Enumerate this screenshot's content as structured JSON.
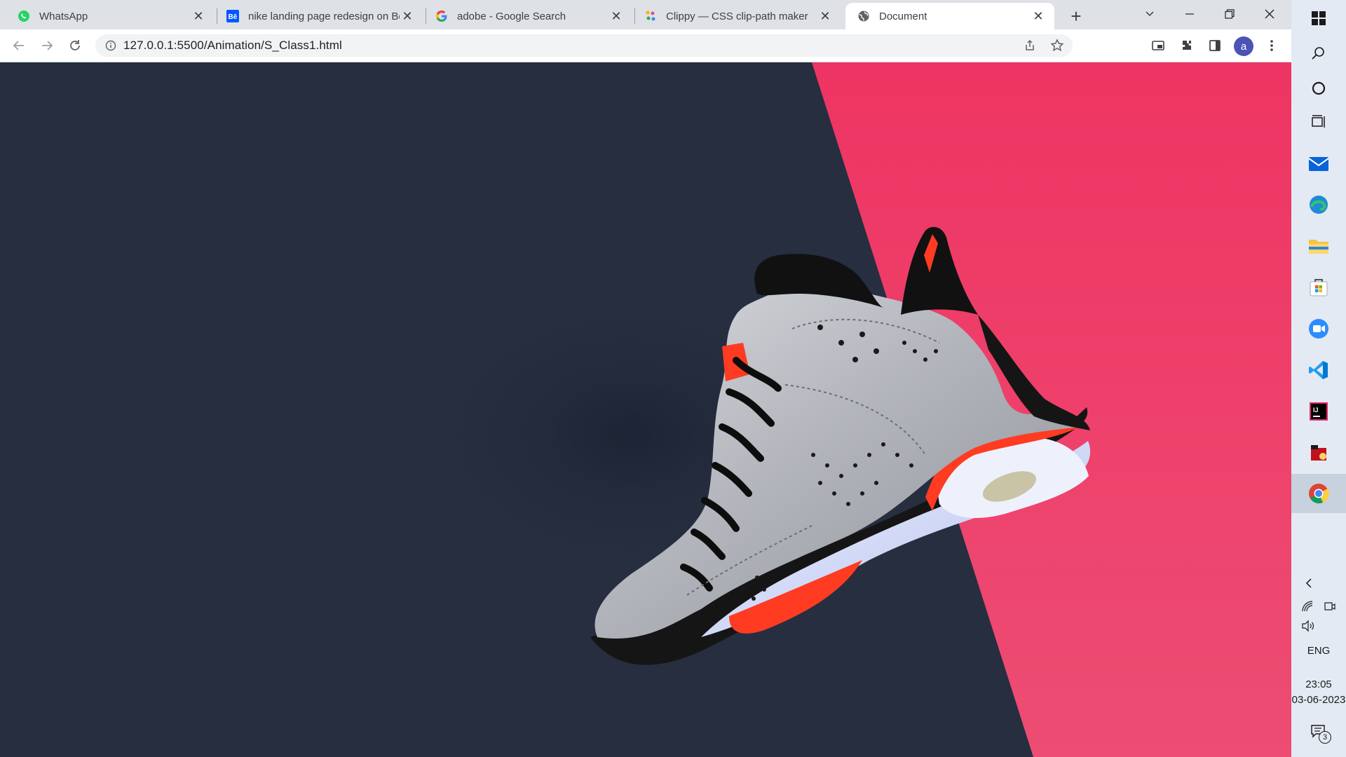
{
  "browser": {
    "tabs": [
      {
        "title": "WhatsApp",
        "icon": "whatsapp-icon"
      },
      {
        "title": "nike landing page redesign on Be",
        "icon": "behance-icon"
      },
      {
        "title": "adobe - Google Search",
        "icon": "google-icon"
      },
      {
        "title": "Clippy — CSS clip-path maker",
        "icon": "clippy-icon"
      },
      {
        "title": "Document",
        "icon": "globe-icon",
        "active": true
      }
    ],
    "new_tab": "+",
    "url": "127.0.0.1:5500/Animation/S_Class1.html",
    "profile_initial": "a"
  },
  "page": {
    "colors": {
      "background": "#262e40",
      "accent": "#ee3462",
      "shoe_silver": "#b9bcc2",
      "shoe_red": "#ff3b22"
    }
  },
  "taskbar": {
    "language": "ENG",
    "time": "23:05",
    "date": "03-06-2023",
    "notification_count": "3",
    "apps": [
      "windows-start-icon",
      "search-icon",
      "cortana-icon",
      "task-view-icon",
      "mail-icon",
      "edge-icon",
      "file-explorer-icon",
      "store-icon",
      "zoom-icon",
      "vscode-icon",
      "intellij-icon",
      "app-icon",
      "chrome-icon"
    ]
  }
}
